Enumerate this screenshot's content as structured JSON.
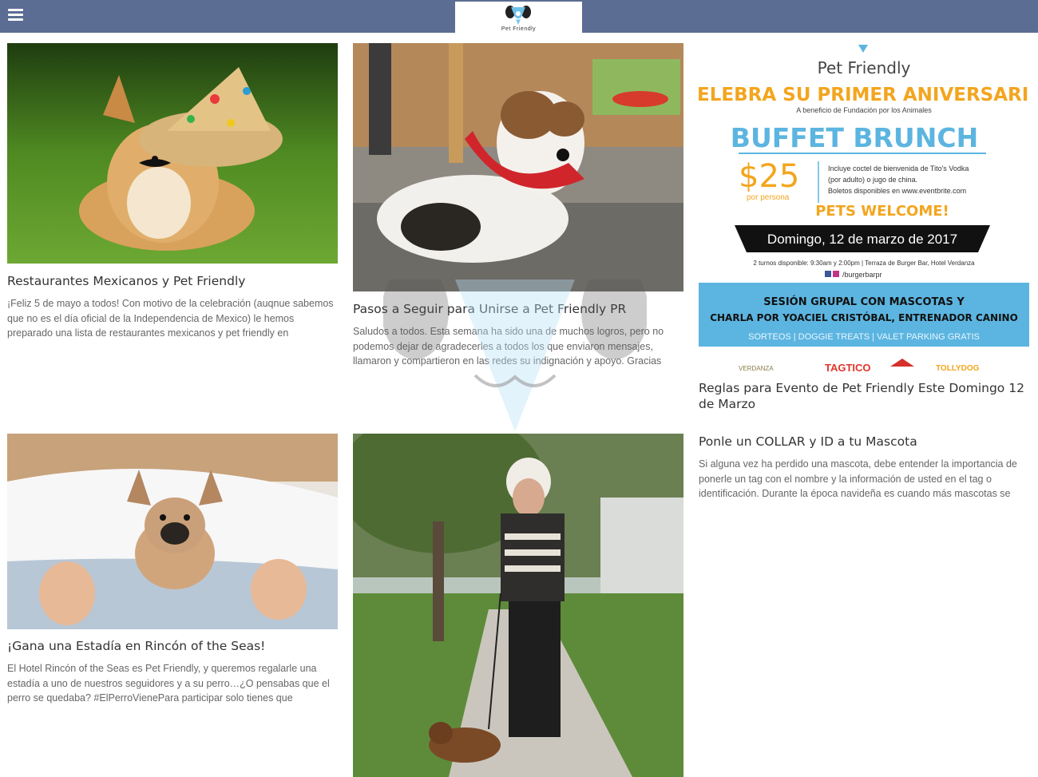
{
  "header": {
    "menu_icon": "hamburger-menu-icon",
    "logo_text": "Pet Friendly",
    "bar_color": "#5b6d93"
  },
  "posts": [
    {
      "title": "Restaurantes Mexicanos y Pet Friendly",
      "excerpt": "¡Feliz 5 de mayo a todos! Con motivo de la celebración (auqnue sabemos que no es el día oficial de la Independencia de Mexico) le hemos preparado una lista de restaurantes mexicanos y pet friendly en"
    },
    {
      "title": "Pasos a Seguir para Unirse a Pet Friendly PR",
      "excerpt": "Saludos a todos. Esta semana ha sido una de muchos logros, pero no podemos dejar de agradecerles a todos los que enviaron mensajes, llamaron y compartieron en las redes su indignación y apoyo. Gracias"
    },
    {
      "title": "Reglas para Evento de Pet Friendly Este Domingo 12 de Marzo",
      "excerpt": ""
    },
    {
      "title": "¡Gana una Estadía en Rincón of the Seas!",
      "excerpt": "El Hotel Rincón of the Seas es Pet Friendly, y queremos regalarle una estadía a uno de nuestros seguidores y a su perro…¿O pensabas que el perro se quedaba? #ElPerroVienePara participar solo tienes que"
    },
    {
      "title": "",
      "excerpt": ""
    },
    {
      "title": "Ponle un COLLAR y ID a tu Mascota",
      "excerpt": "Si alguna vez ha perdido una mascota, debe entender la importancia de ponerle un tag con el nombre y la información de  usted en el tag o identificación. Durante la época navideña es cuando más mascotas se"
    }
  ],
  "poster": {
    "brand": "Pet Friendly",
    "headline": "CELEBRA SU PRIMER ANIVERSARIO",
    "subheadline": "A beneficio de Fundación por los Animales",
    "event": "BUFFET BRUNCH",
    "price": "$25",
    "price_note": "por persona",
    "details": [
      "Incluye coctel de bienvenida de Tito's Vodka",
      "(por adulto) o jugo de china.",
      "Boletos disponibles en www.eventbrite.com"
    ],
    "pets_welcome": "PETS WELCOME!",
    "date": "Domingo, 12 de marzo de 2017",
    "schedule": "2 turnos disponible: 9:30am y 2:00pm | Terraza de Burger Bar, Hotel Verdanza",
    "social": "/burgerbarpr",
    "session_line1": "SESIÓN GRUPAL CON MASCOTAS Y",
    "session_line2": "CHARLA POR YOACIEL CRISTÓBAL, ENTRENADOR CANINO",
    "session_line3": "SORTEOS | DOGGIE TREATS | VALET PARKING GRATIS",
    "sponsors": [
      "VERDANZA",
      "TAGTICO",
      "",
      "TOLLYDOG"
    ],
    "colors": {
      "orange": "#f3a51e",
      "blue": "#5cb5e0",
      "black": "#111111"
    }
  }
}
